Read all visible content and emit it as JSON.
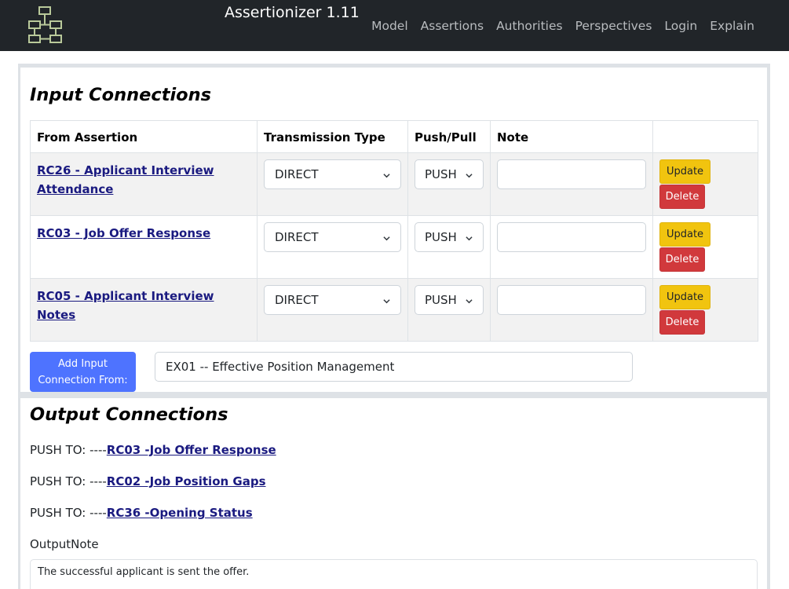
{
  "app": {
    "title": "Assertionizer 1.11",
    "nav": [
      "Model",
      "Assertions",
      "Authorities",
      "Perspectives",
      "Login",
      "Explain"
    ]
  },
  "input_section": {
    "title": "Input Connections",
    "headers": [
      "From Assertion",
      "Transmission Type",
      "Push/Pull",
      "Note",
      ""
    ],
    "rows": [
      {
        "link_line1": "RC26 - Applicant Interview",
        "link_line2": "Attendance",
        "type": "DIRECT",
        "push": "PUSH",
        "note": "",
        "update": "Update",
        "delete": "Delete"
      },
      {
        "link_line1": "RC03 - Job Offer Response",
        "link_line2": "",
        "type": "DIRECT",
        "push": "PUSH",
        "note": "",
        "update": "Update",
        "delete": "Delete"
      },
      {
        "link_line1": "RC05 - Applicant Interview Notes",
        "link_line2": "",
        "type": "DIRECT",
        "push": "PUSH",
        "note": "",
        "update": "Update",
        "delete": "Delete"
      }
    ],
    "add_button_line1": "Add Input",
    "add_button_line2": "Connection From:",
    "from_value": "EX01 -- Effective Position Management"
  },
  "output_section": {
    "title": "Output Connections",
    "items": [
      {
        "prefix": "PUSH TO: ----",
        "link": "RC03 -Job Offer Response"
      },
      {
        "prefix": "PUSH TO: ----",
        "link": "RC02 -Job Position Gaps"
      },
      {
        "prefix": "PUSH TO: ----",
        "link": "RC36 -Opening Status"
      }
    ],
    "note_label": "OutputNote",
    "note_value": "The successful applicant is sent the offer."
  },
  "colors": {
    "navbar": "#212529",
    "link": "#1a1a80",
    "update_button": "#f1c40f",
    "delete_button": "#d1393c",
    "add_button": "#4e73ff"
  },
  "icons": {
    "logo": "hierarchy-diagram-icon",
    "select_arrow": "chevron-down-icon"
  }
}
